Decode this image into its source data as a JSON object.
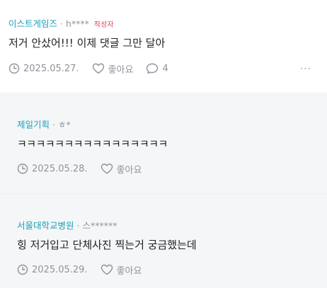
{
  "comments": [
    {
      "author": "이스트게임즈",
      "separator": "·",
      "user": "h****",
      "badge": "작성자",
      "text": "저거 안샀어!!! 이제 댓글 그만 달아",
      "date": "2025.05.27.",
      "like_label": "좋아요",
      "reply_count": "4",
      "more": "···"
    },
    {
      "author": "제일기획",
      "separator": "·",
      "user": "ㅎ*",
      "text": "ㅋㅋㅋㅋㅋㅋㅋㅋㅋㅋㅋㅋㅋㅋㅋㅋ",
      "date": "2025.05.28.",
      "like_label": "좋아요"
    },
    {
      "author": "서울대학교병원",
      "separator": "·",
      "user": "스******",
      "text": "힝 저거입고 단체사진 찍는거 궁금했는데",
      "date": "2025.05.29.",
      "like_label": "좋아요"
    }
  ],
  "colors": {
    "author": "#1aa0b6",
    "badge": "#e2405a",
    "meta_gray": "#8e949b",
    "reply_bg": "#f5f6f8"
  },
  "icons": [
    "clock-icon",
    "heart-icon",
    "speech-bubble-icon",
    "more-icon"
  ]
}
